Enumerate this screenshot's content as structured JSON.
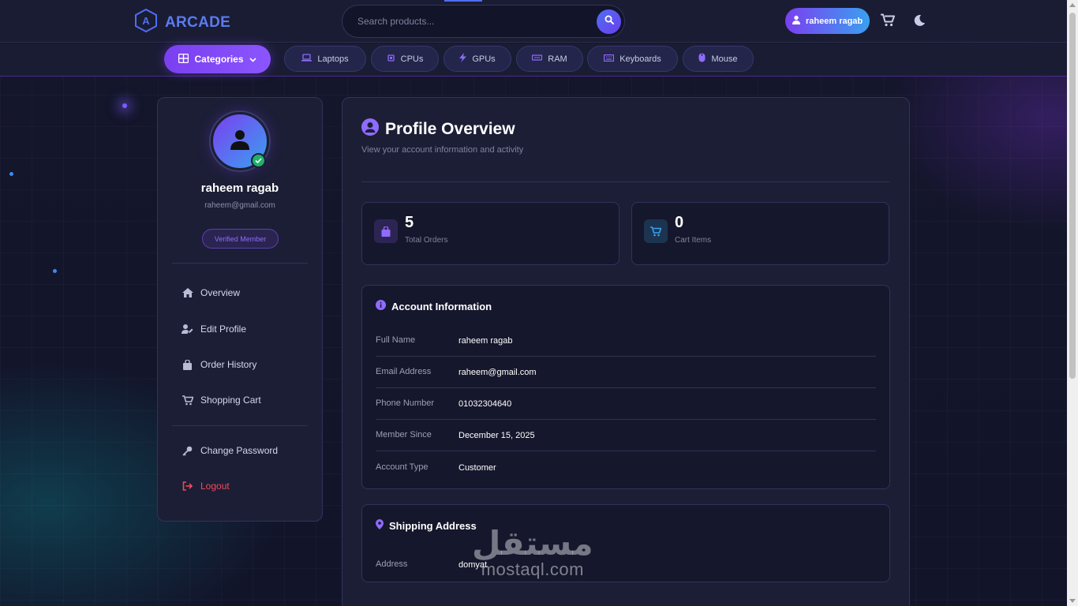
{
  "header": {
    "logo_title": "ARCADE",
    "search_placeholder": "Search products...",
    "user_name": "raheem ragab"
  },
  "categories": {
    "main_label": "Categories",
    "chips": [
      "Laptops",
      "CPUs",
      "GPUs",
      "RAM",
      "Keyboards",
      "Mouse"
    ]
  },
  "sidebar": {
    "name": "raheem ragab",
    "email": "raheem@gmail.com",
    "badge": "Verified Member",
    "nav": [
      "Overview",
      "Edit Profile",
      "Order History",
      "Shopping Cart"
    ],
    "secondary": [
      "Change Password",
      "Logout"
    ]
  },
  "main": {
    "title": "Profile Overview",
    "subtitle": "View your account information and activity",
    "stats": [
      {
        "value": "5",
        "label": "Total Orders"
      },
      {
        "value": "0",
        "label": "Cart Items"
      }
    ],
    "account": {
      "title": "Account Information",
      "rows": [
        {
          "key": "Full Name",
          "value": "raheem ragab"
        },
        {
          "key": "Email Address",
          "value": "raheem@gmail.com"
        },
        {
          "key": "Phone Number",
          "value": "01032304640"
        },
        {
          "key": "Member Since",
          "value": "December 15, 2025"
        },
        {
          "key": "Account Type",
          "value": "Customer"
        }
      ]
    },
    "shipping": {
      "title": "Shipping Address",
      "rows": [
        {
          "key": "Address",
          "value": "domyat"
        }
      ]
    }
  },
  "watermark": {
    "arabic": "مستقل",
    "latin": "mostaql.com"
  },
  "colors": {
    "accent": "#7b3ff0",
    "accent2": "#3aa0f0",
    "logout": "#f04a5a",
    "verified": "#22b06a"
  }
}
